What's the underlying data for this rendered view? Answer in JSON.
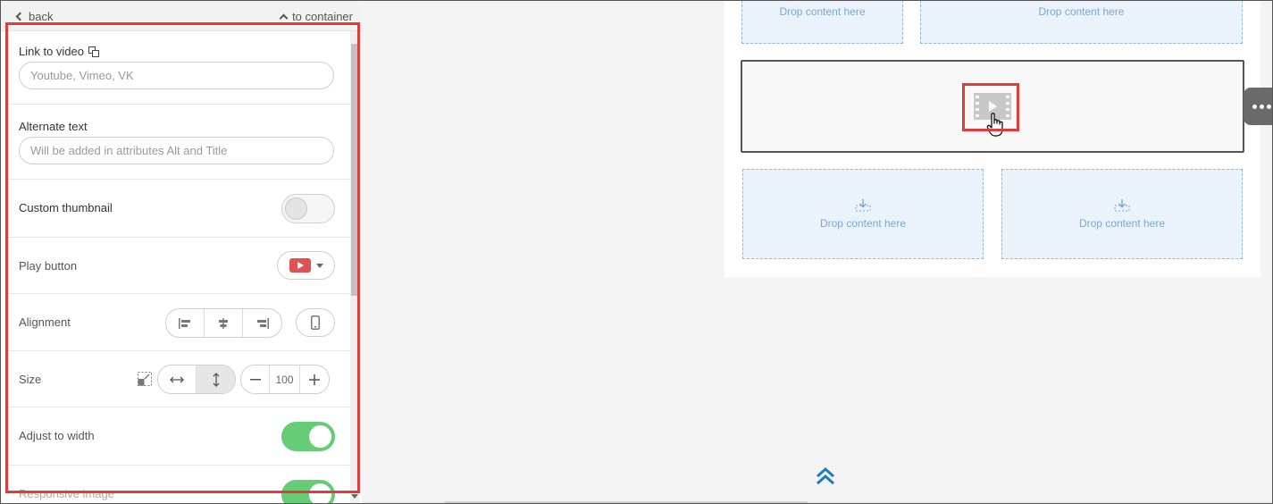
{
  "panel": {
    "back_label": "back",
    "container_label": "to container",
    "link_to_video": {
      "label": "Link to video",
      "placeholder": "Youtube, Vimeo, VK",
      "icon": "copy-icon"
    },
    "alternate_text": {
      "label": "Alternate text",
      "placeholder": "Will be added in attributes Alt and Title"
    },
    "custom_thumbnail": {
      "label": "Custom thumbnail",
      "enabled": false
    },
    "play_button": {
      "label": "Play button",
      "selected": "youtube-play",
      "color": "#e05252"
    },
    "alignment": {
      "label": "Alignment",
      "options": [
        "align-left",
        "align-center",
        "align-right"
      ],
      "mobile_icon": "mobile-icon"
    },
    "size": {
      "label": "Size",
      "modes": [
        "fit-width",
        "fit-height"
      ],
      "active_mode": "fit-height",
      "value": "100"
    },
    "adjust_to_width": {
      "label": "Adjust to width",
      "enabled": true
    },
    "responsive_image": {
      "label": "Responsive image",
      "enabled": true
    }
  },
  "canvas": {
    "drop_text": "Drop content here",
    "video_icon": "video-play-icon"
  },
  "colors": {
    "accent_red": "#e03c3c",
    "toggle_on": "#66cc77",
    "drop_blue": "#7aa7d6"
  }
}
